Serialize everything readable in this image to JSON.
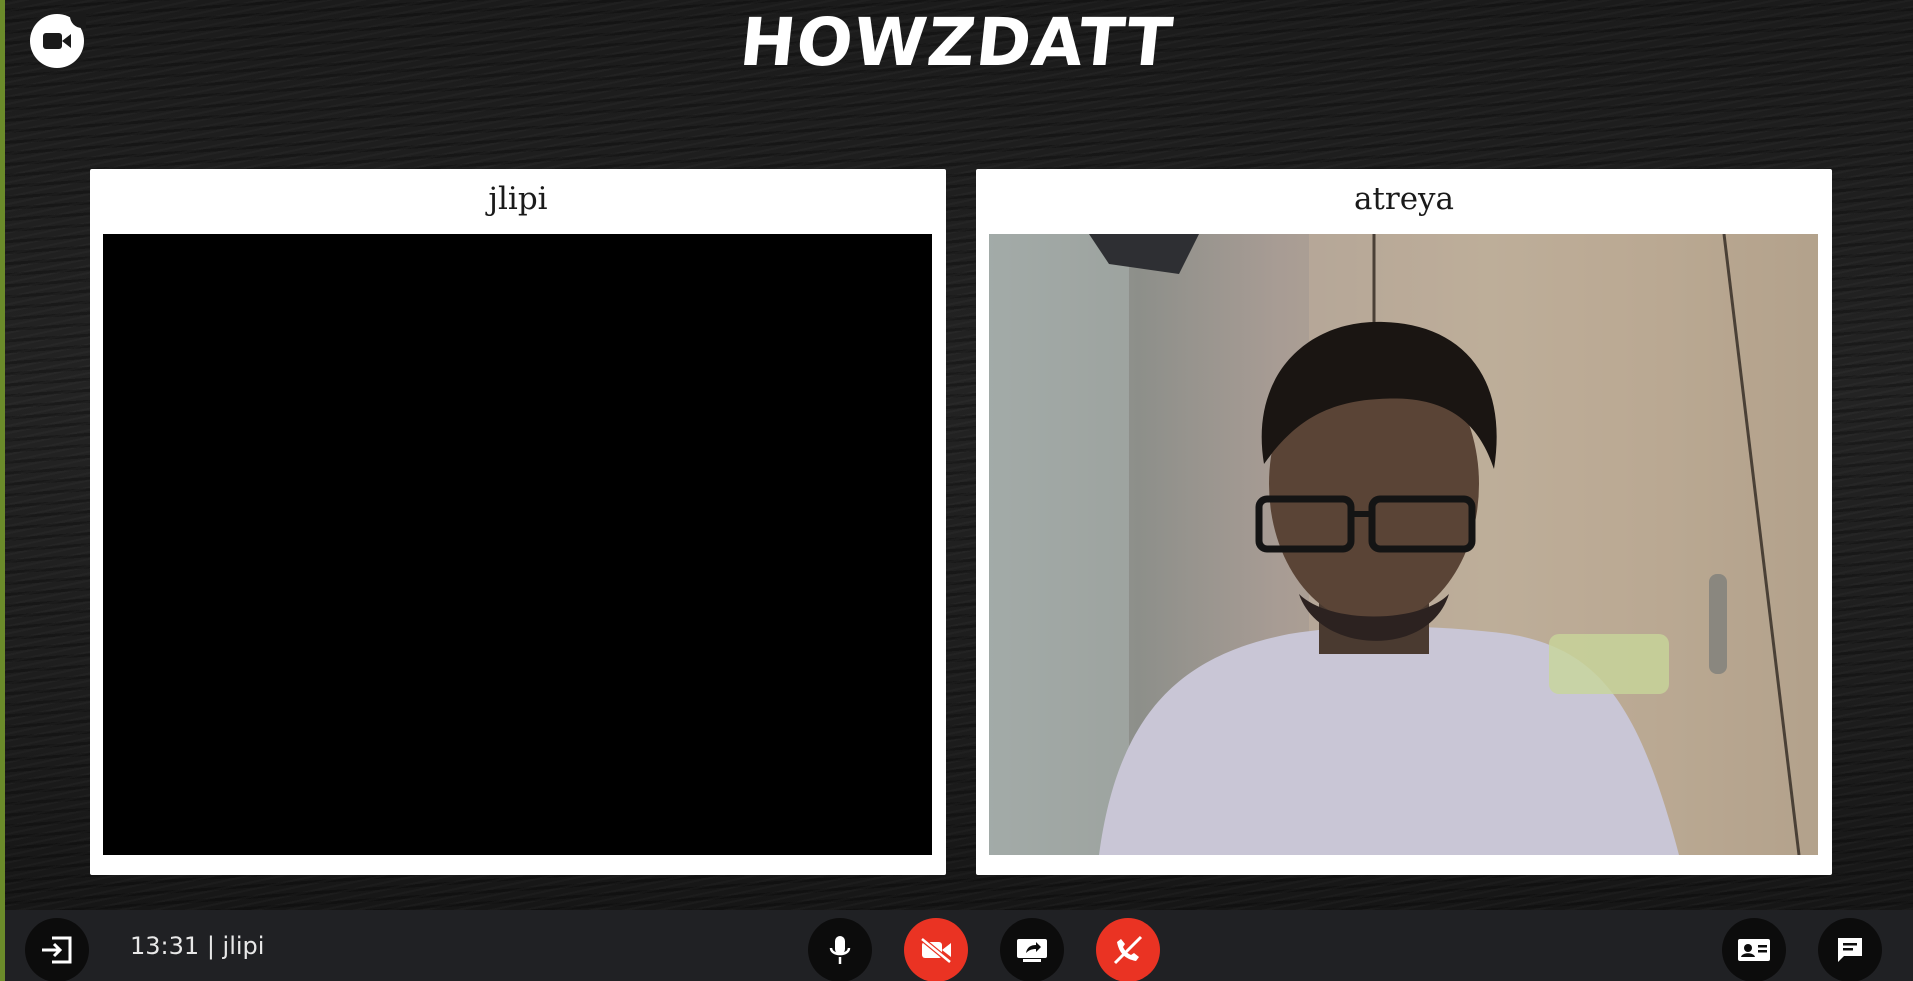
{
  "app": {
    "title": "HOWZDATT",
    "logo_icon": "video-camera-icon"
  },
  "participants": [
    {
      "name": "jlipi",
      "camera": "off"
    },
    {
      "name": "atreya",
      "camera": "on"
    }
  ],
  "footer": {
    "time": "13:31",
    "separator": "|",
    "current_user": "jlipi",
    "controls_left": [
      "leave-icon"
    ],
    "controls_center": [
      "microphone-icon",
      "camera-off-icon",
      "share-screen-icon",
      "end-call-icon"
    ],
    "controls_right": [
      "participants-card-icon",
      "chat-icon"
    ]
  },
  "colors": {
    "background": "#1b1b1b",
    "tile": "#ffffff",
    "danger": "#ea3323",
    "control_dark": "#0c0c0c",
    "bar": "#202124",
    "accent_strip": "#6b8b2a"
  }
}
